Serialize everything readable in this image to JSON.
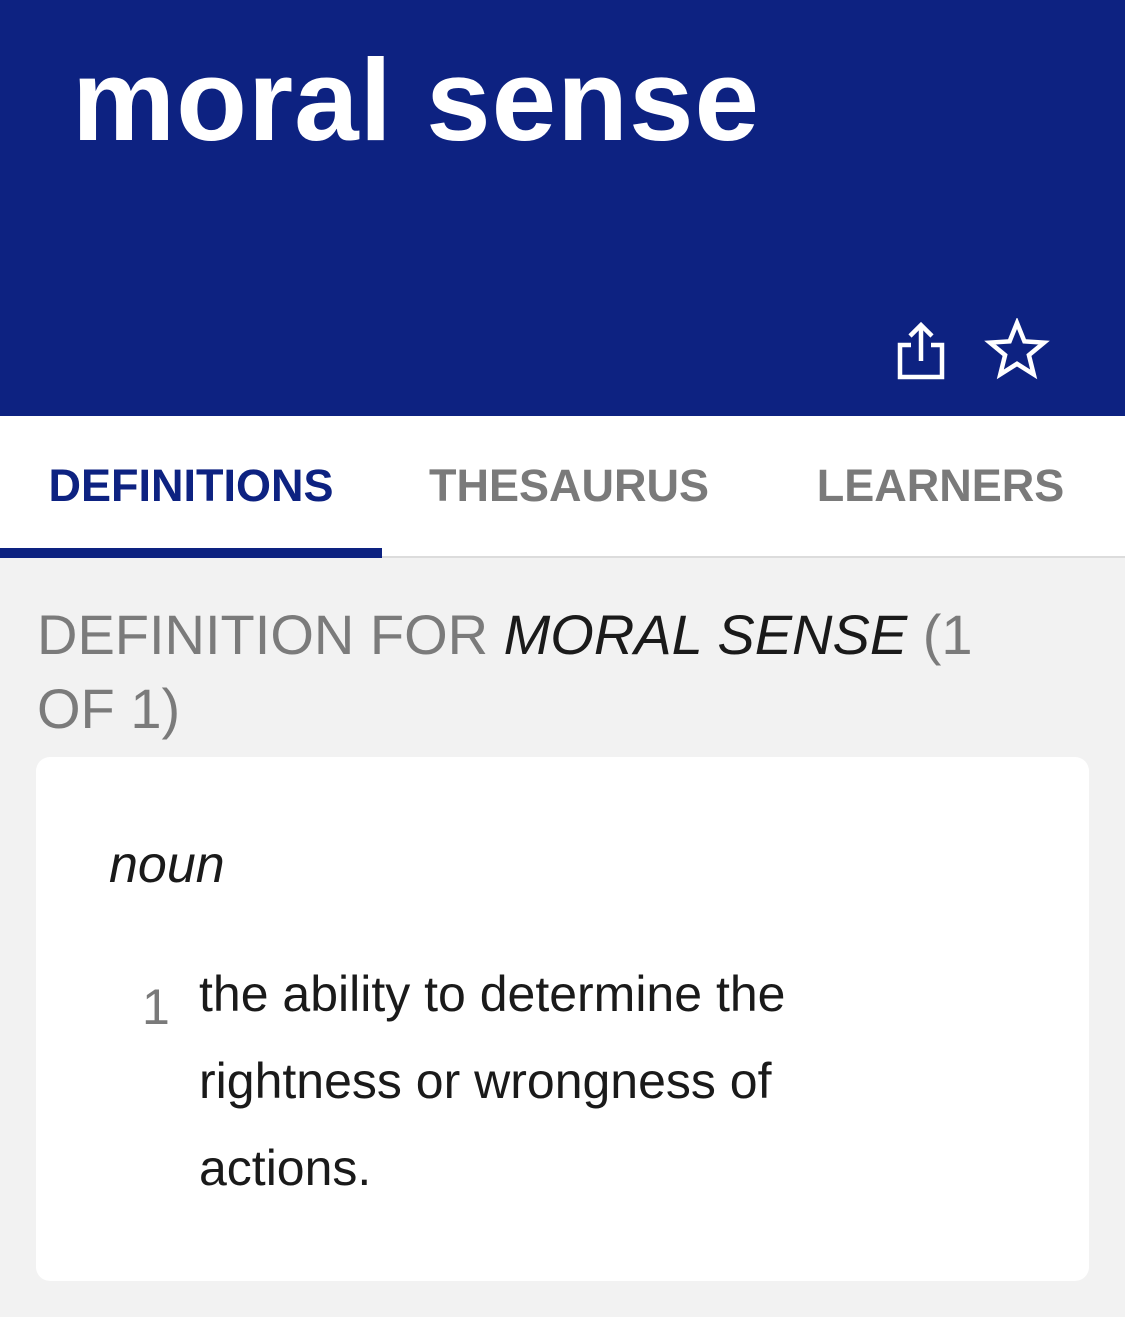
{
  "header": {
    "headword": "moral sense",
    "share_icon": "share-icon",
    "favorite_icon": "star-outline-icon",
    "background_color": "#0d2281"
  },
  "tabs": [
    {
      "label": "DEFINITIONS",
      "active": true
    },
    {
      "label": "THESAURUS",
      "active": false
    },
    {
      "label": "LEARNERS",
      "active": false
    }
  ],
  "definition_section": {
    "heading_prefix": "DEFINITION FOR",
    "heading_term": "MORAL SENSE",
    "heading_count": "(1 OF 1)"
  },
  "entry": {
    "part_of_speech": "noun",
    "senses": [
      {
        "number": "1",
        "text": "the ability to determine the rightness or wrongness of actions."
      }
    ]
  }
}
